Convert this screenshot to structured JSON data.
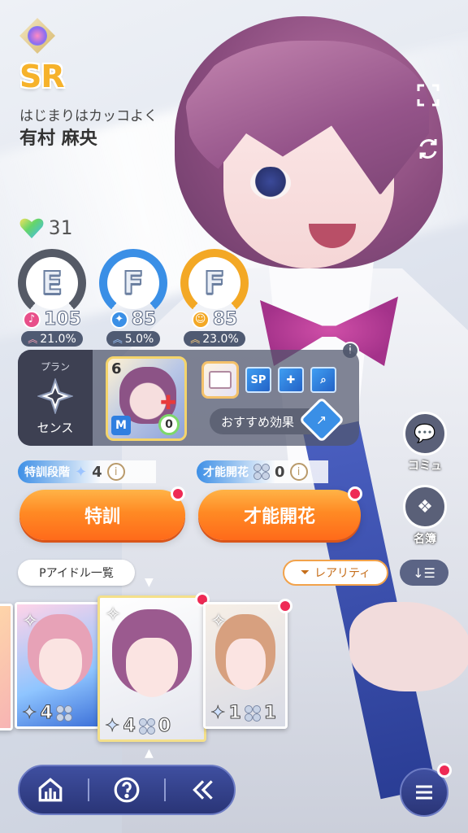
{
  "card": {
    "rarity": "SR",
    "title": "はじまりはカッコよく",
    "idol_name": "有村 麻央"
  },
  "stamina": {
    "value": "31"
  },
  "stats": [
    {
      "grade": "E",
      "value": "105",
      "rate": "21.0%",
      "color": "#e84f8a",
      "icon": "vocal-icon"
    },
    {
      "grade": "F",
      "value": "85",
      "rate": "5.0%",
      "color": "#3a8fe6",
      "icon": "dance-icon"
    },
    {
      "grade": "F",
      "value": "85",
      "rate": "23.0%",
      "color": "#f3a825",
      "icon": "visual-icon"
    }
  ],
  "plan": {
    "label": "プラン",
    "name": "センス"
  },
  "support": {
    "level": "6",
    "type": "M",
    "count": "0"
  },
  "effects": {
    "sp": "SP",
    "recommend": "おすすめ効果"
  },
  "training": {
    "label": "特訓段階",
    "count": "4",
    "button": "特訓"
  },
  "bloom": {
    "label": "才能開花",
    "count": "0",
    "button": "才能開花"
  },
  "side": {
    "commu": "コミュ",
    "meibo": "名簿"
  },
  "list": {
    "title": "Pアイドル一覧",
    "rarity_filter": "レアリティ"
  },
  "cards": [
    {
      "training": "4",
      "bloom": ""
    },
    {
      "training": "4",
      "bloom": ""
    },
    {
      "training": "4",
      "bloom": "0"
    },
    {
      "training": "1",
      "bloom": "1"
    }
  ],
  "colors": {
    "accent_orange": "#ff7a22",
    "nav_blue": "#2a3577",
    "badge_red": "#ee2a55"
  }
}
